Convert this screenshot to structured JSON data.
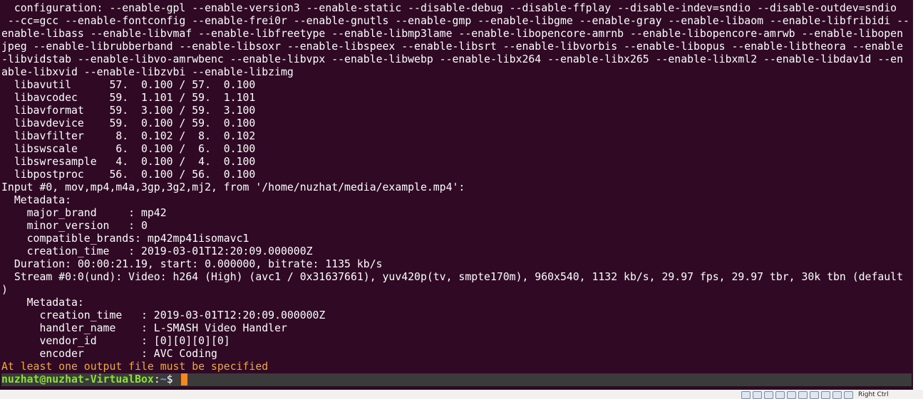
{
  "terminal": {
    "lines": [
      "  configuration: --enable-gpl --enable-version3 --enable-static --disable-debug --disable-ffplay --disable-indev=sndio --disable-outdev=sndio",
      " --cc=gcc --enable-fontconfig --enable-frei0r --enable-gnutls --enable-gmp --enable-libgme --enable-gray --enable-libaom --enable-libfribidi --",
      "enable-libass --enable-libvmaf --enable-libfreetype --enable-libmp3lame --enable-libopencore-amrnb --enable-libopencore-amrwb --enable-libopen",
      "jpeg --enable-librubberband --enable-libsoxr --enable-libspeex --enable-libsrt --enable-libvorbis --enable-libopus --enable-libtheora --enable",
      "-libvidstab --enable-libvo-amrwbenc --enable-libvpx --enable-libwebp --enable-libx264 --enable-libx265 --enable-libxml2 --enable-libdav1d --en",
      "able-libxvid --enable-libzvbi --enable-libzimg",
      "  libavutil      57.  0.100 / 57.  0.100",
      "  libavcodec     59.  1.101 / 59.  1.101",
      "  libavformat    59.  3.100 / 59.  3.100",
      "  libavdevice    59.  0.100 / 59.  0.100",
      "  libavfilter     8.  0.102 /  8.  0.102",
      "  libswscale      6.  0.100 /  6.  0.100",
      "  libswresample   4.  0.100 /  4.  0.100",
      "  libpostproc    56.  0.100 / 56.  0.100",
      "Input #0, mov,mp4,m4a,3gp,3g2,mj2, from '/home/nuzhat/media/example.mp4':",
      "  Metadata:",
      "    major_brand     : mp42",
      "    minor_version   : 0",
      "    compatible_brands: mp42mp41isomavc1",
      "    creation_time   : 2019-03-01T12:20:09.000000Z",
      "  Duration: 00:00:21.19, start: 0.000000, bitrate: 1135 kb/s",
      "  Stream #0:0(und): Video: h264 (High) (avc1 / 0x31637661), yuv420p(tv, smpte170m), 960x540, 1132 kb/s, 29.97 fps, 29.97 tbr, 30k tbn (default",
      ")",
      "    Metadata:",
      "      creation_time   : 2019-03-01T12:20:09.000000Z",
      "      handler_name    : L-SMASH Video Handler",
      "      vendor_id       : [0][0][0][0]",
      "      encoder         : AVC Coding"
    ],
    "error_line": "At least one output file must be specified",
    "prompt": {
      "user_host": "nuzhat@nuzhat-VirtualBox",
      "separator": ":",
      "path": "~",
      "symbol": "$ "
    },
    "colors": {
      "background": "#300a24",
      "text": "#ffffff",
      "error": "#f2a83a",
      "user_host": "#8ae234",
      "path": "#729fcf",
      "cursor": "#f08a24"
    }
  },
  "statusbar": {
    "host_key_label": "Right Ctrl",
    "icons": [
      "hard-disk-icon",
      "optical-drive-icon",
      "audio-icon",
      "network-icon",
      "usb-icon",
      "shared-folder-icon",
      "display-icon",
      "recording-icon",
      "mouse-integration-icon",
      "keyboard-icon"
    ]
  }
}
